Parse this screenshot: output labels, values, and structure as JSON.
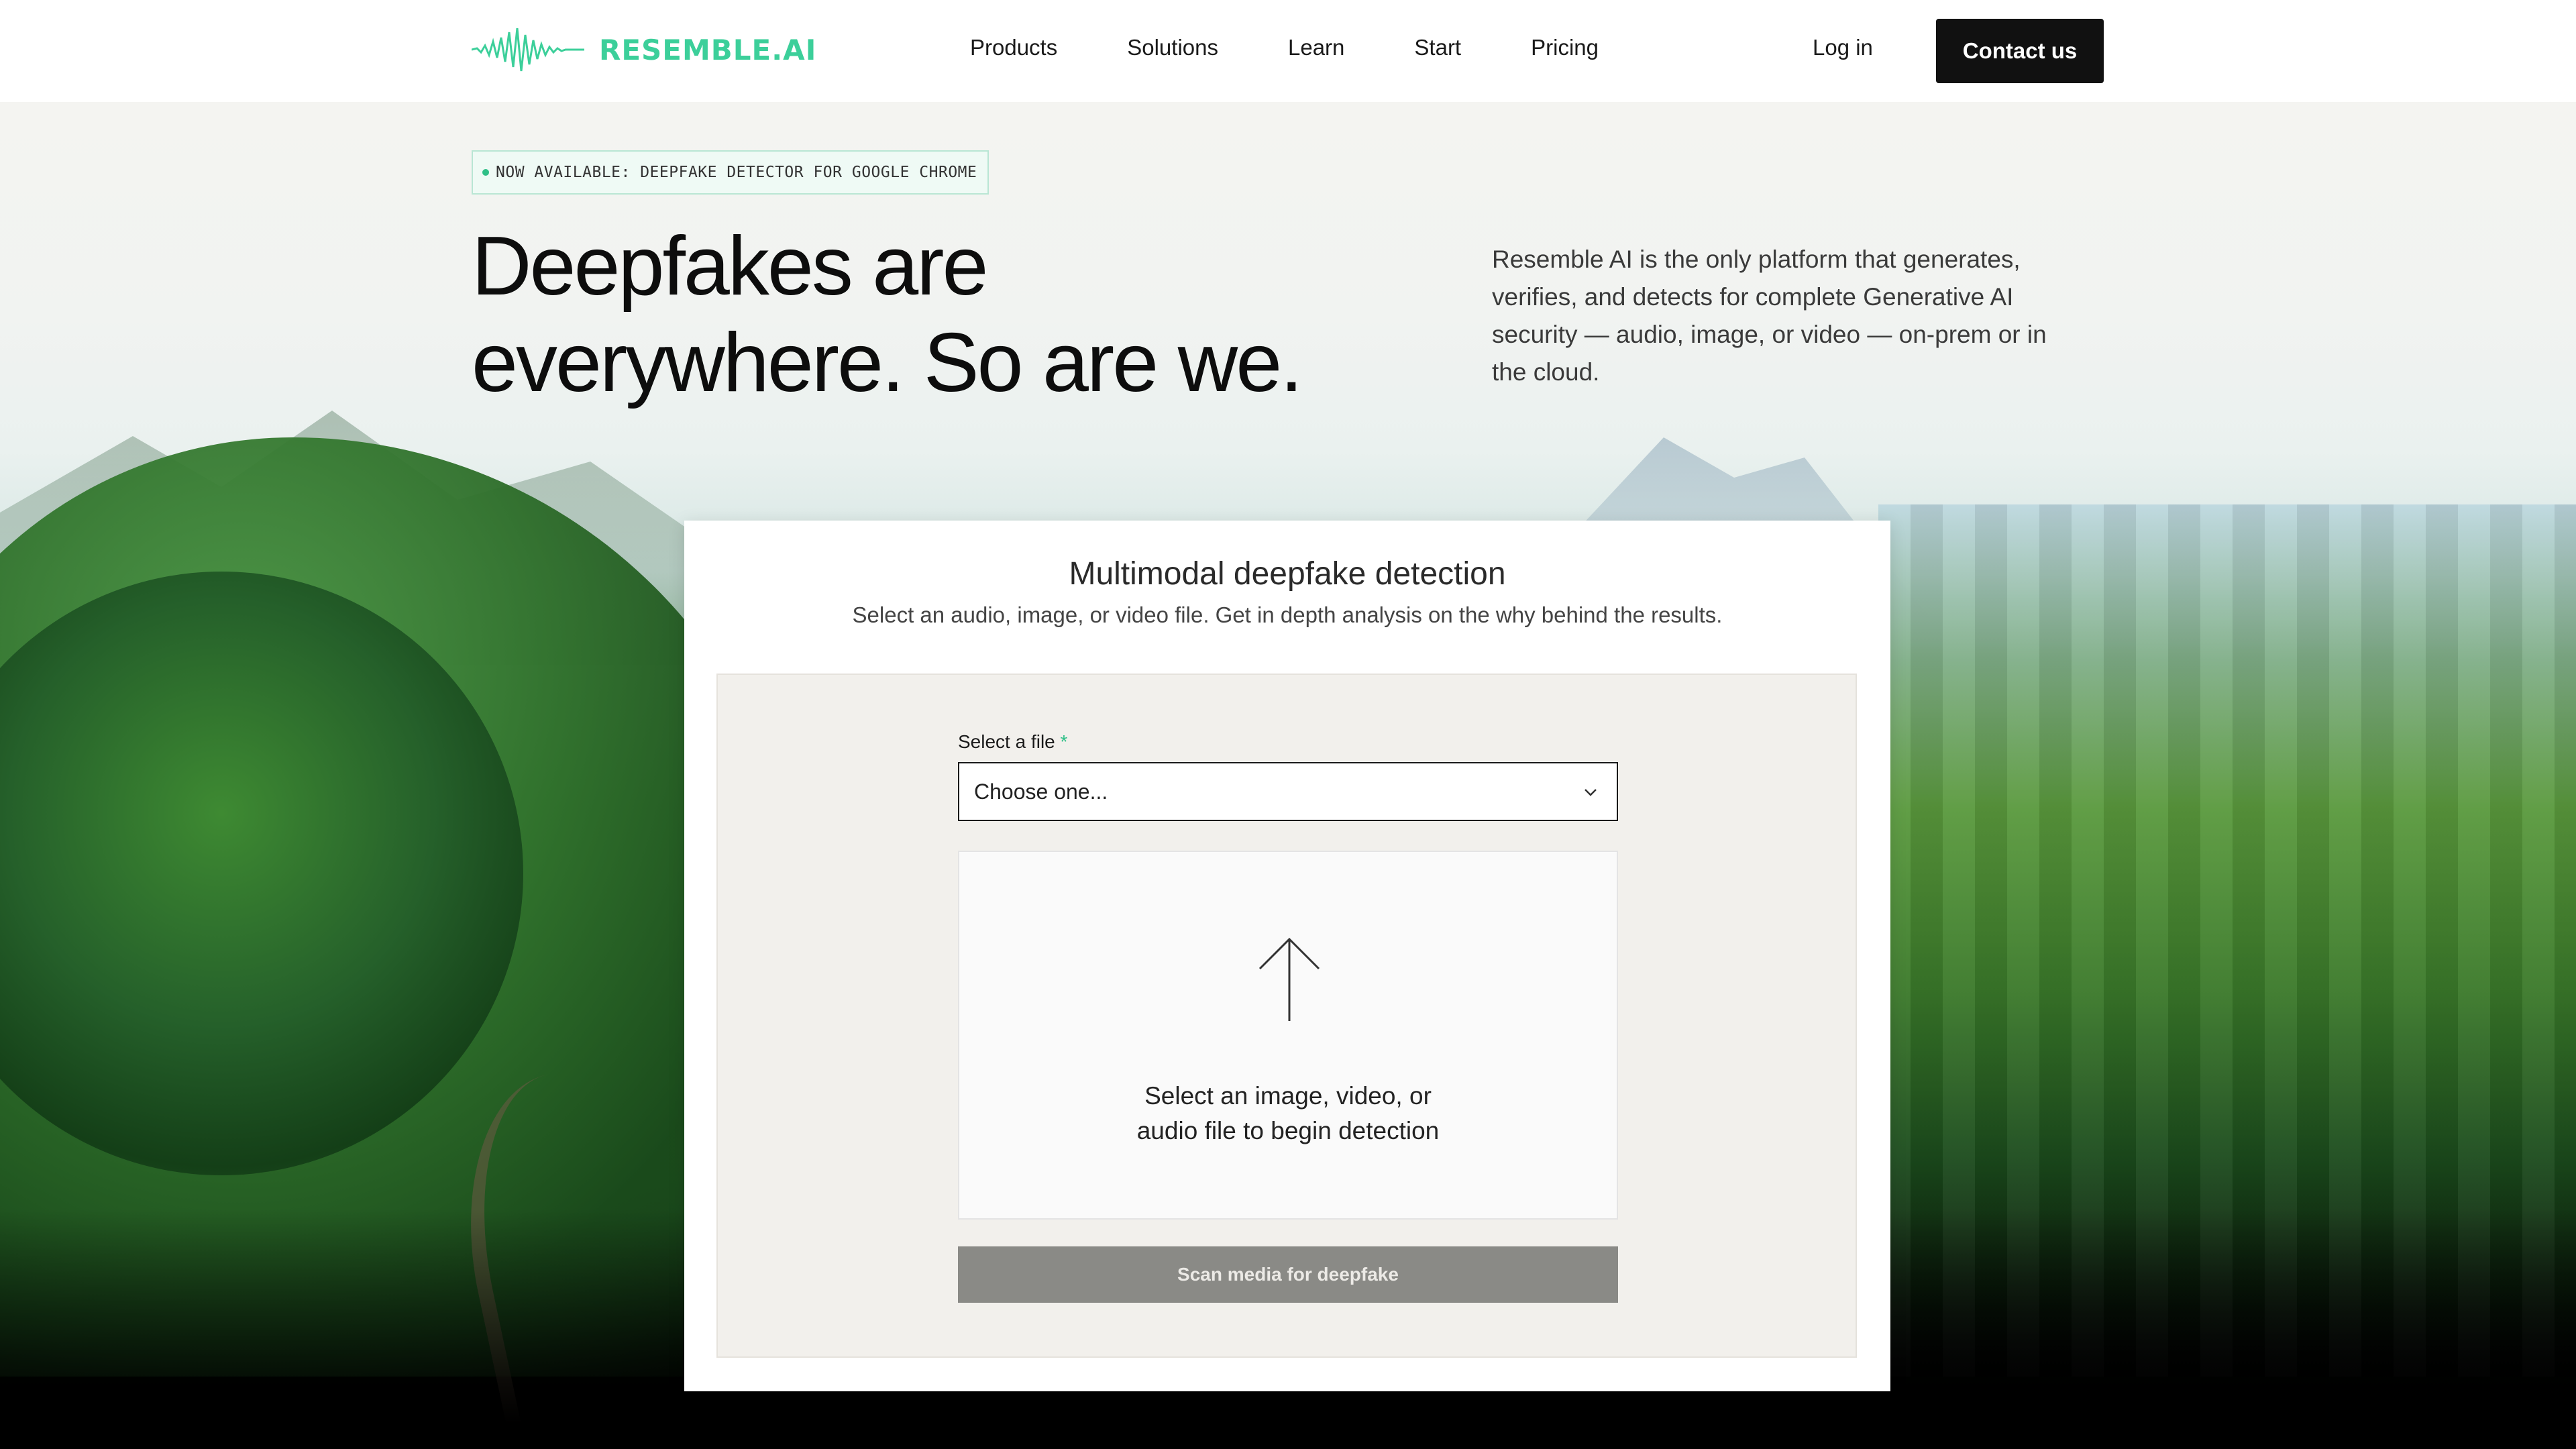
{
  "nav": {
    "logo_text": "RESEMBLE.AI",
    "links": [
      "Products",
      "Solutions",
      "Learn",
      "Start",
      "Pricing"
    ],
    "login": "Log in",
    "contact": "Contact us"
  },
  "hero": {
    "badge": "NOW AVAILABLE: DEEPFAKE DETECTOR FOR GOOGLE CHROME",
    "title_line1": "Deepfakes are",
    "title_line2": "everywhere. So are we.",
    "description": "Resemble AI is the only platform that generates, verifies, and detects for complete Generative AI security — audio, image, or video — on-prem or in the cloud."
  },
  "detector": {
    "title": "Multimodal deepfake detection",
    "subtitle": "Select an audio, image, or video file. Get in depth analysis on the why behind the results.",
    "field_label": "Select a file",
    "required_mark": "*",
    "select_value": "Choose one...",
    "drop_line1": "Select an image, video, or",
    "drop_line2": "audio file to begin detection",
    "scan_button": "Scan media for deepfake"
  },
  "colors": {
    "brand": "#3ccf9a",
    "button_dark": "#111111",
    "scan_disabled": "#8a8a86"
  },
  "icons": [
    "waveform-logo-icon",
    "chevron-down-icon",
    "upload-arrow-icon"
  ]
}
